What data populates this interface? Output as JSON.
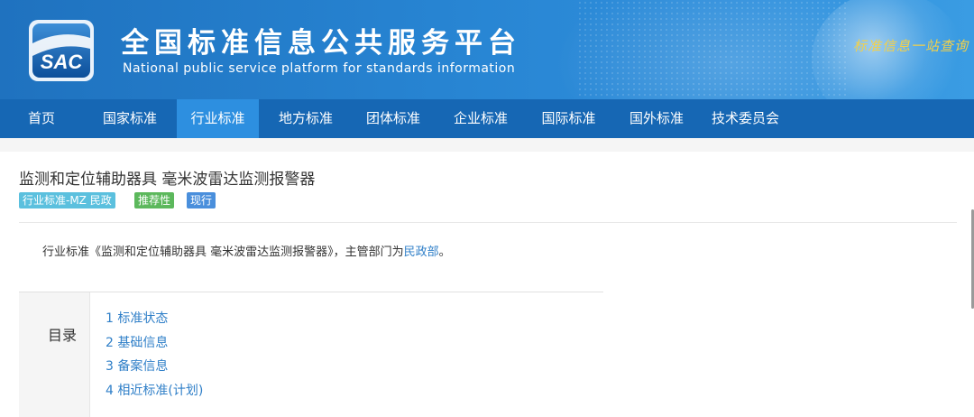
{
  "header": {
    "logo_text": "SAC",
    "title": "全国标准信息公共服务平台",
    "subtitle": "National public service platform  for standards information",
    "slogan": "标准信息一站查询"
  },
  "nav": {
    "items": [
      "首页",
      "国家标准",
      "行业标准",
      "地方标准",
      "团体标准",
      "企业标准",
      "国际标准",
      "国外标准",
      "技术委员会"
    ],
    "active": "行业标准"
  },
  "document": {
    "title": "监测和定位辅助器具 毫米波雷达监测报警器",
    "tags": [
      {
        "label": "行业标准-MZ 民政",
        "color": "#5bc0de"
      },
      {
        "label": "推荐性",
        "color": "#5cb85c"
      },
      {
        "label": "现行",
        "color": "#4a8fdc"
      }
    ],
    "description_prefix": "行业标准《监测和定位辅助器具 毫米波雷达监测报警器》，主管部门为",
    "description_link": "民政部",
    "description_suffix": "。"
  },
  "toc": {
    "heading": "目录",
    "items": [
      "1  标准状态",
      "2  基础信息",
      "3  备案信息",
      "4  相近标准(计划)"
    ]
  }
}
